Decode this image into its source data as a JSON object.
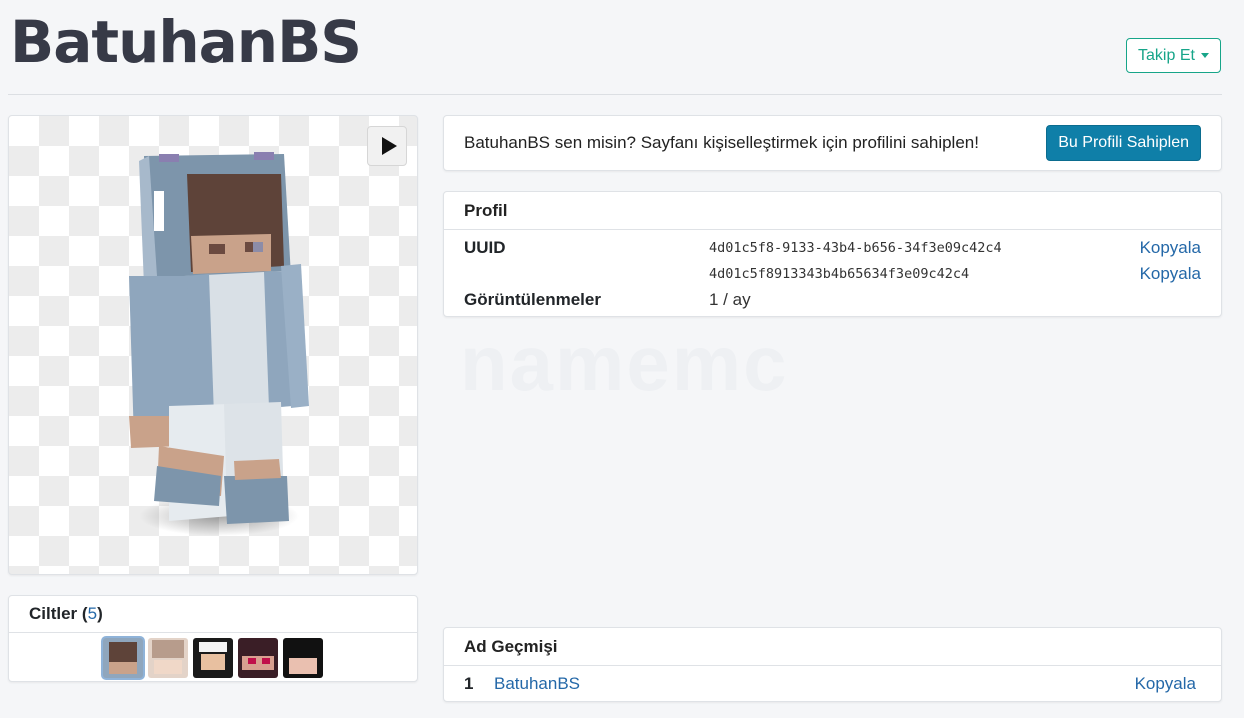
{
  "page": {
    "title": "BatuhanBS",
    "follow_label": "Takip Et",
    "watermark": "namemc"
  },
  "skin_viewer": {
    "play_icon": "play-icon"
  },
  "claim": {
    "text": "BatuhanBS sen misin? Sayfanı kişiselleştirmek için profilini sahiplen!",
    "button_label": "Bu Profili Sahiplen"
  },
  "profile": {
    "header": "Profil",
    "uuid_label": "UUID",
    "uuid_dashed": "4d01c5f8-9133-43b4-b656-34f3e09c42c4",
    "uuid_plain": "4d01c5f8913343b4b65634f3e09c42c4",
    "copy_label": "Kopyala",
    "views_label": "Görüntülenmeler",
    "views_value": "1 / ay"
  },
  "skins": {
    "title": "Ciltler",
    "count": "5",
    "open_paren": "(",
    "close_paren": ")"
  },
  "name_history": {
    "header": "Ad Geçmişi",
    "rows": [
      {
        "index": "1",
        "name": "BatuhanBS",
        "copy": "Kopyala"
      }
    ]
  },
  "colors": {
    "accent_green": "#17a589",
    "primary_blue": "#0f7fa8",
    "link_blue": "#2468a8"
  }
}
